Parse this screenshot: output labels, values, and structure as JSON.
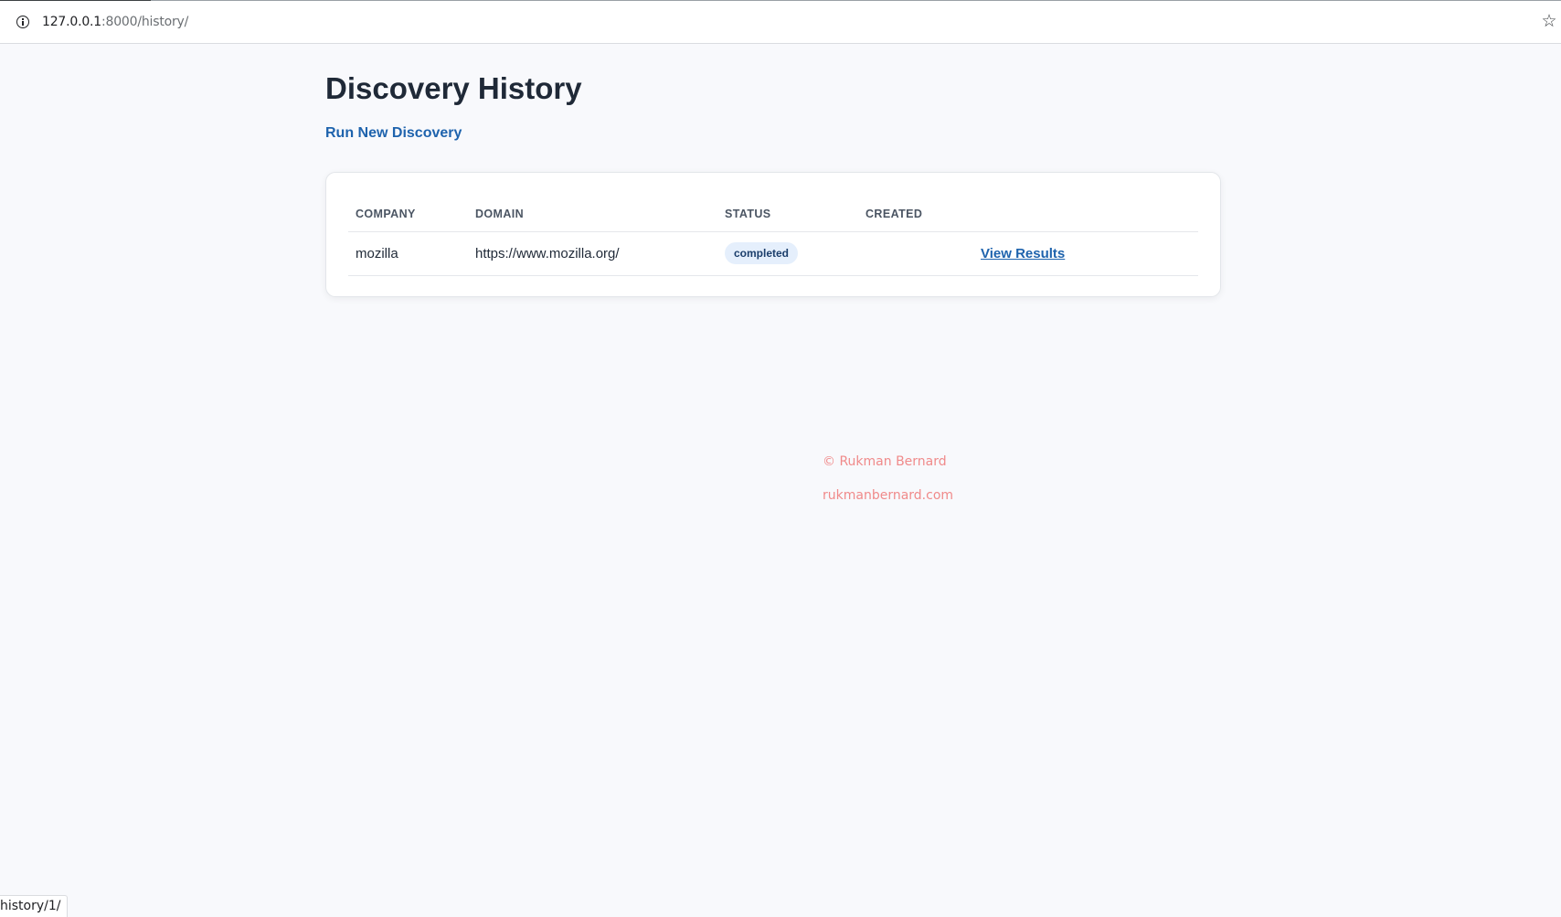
{
  "browser": {
    "url_host": "127.0.0.1",
    "url_path": ":8000/history/",
    "star_icon": "star-outline-icon",
    "info_icon": "info-circle-icon",
    "status_url": "history/1/"
  },
  "page": {
    "title": "Discovery History",
    "new_link": "Run New Discovery"
  },
  "table": {
    "headers": [
      "COMPANY",
      "DOMAIN",
      "STATUS",
      "CREATED",
      ""
    ],
    "rows": [
      {
        "company": "mozilla",
        "domain": "https://www.mozilla.org/",
        "status": "completed",
        "created": "",
        "action": "View Results"
      }
    ]
  },
  "footer": {
    "copyright": "© Rukman Bernard",
    "website": "rukmanbernard.com"
  },
  "colors": {
    "background": "#f8f9fc",
    "link": "#1e63ad",
    "footer_text": "#f08a8a",
    "badge_bg": "#e5effc",
    "badge_text": "#1b3e6b"
  }
}
